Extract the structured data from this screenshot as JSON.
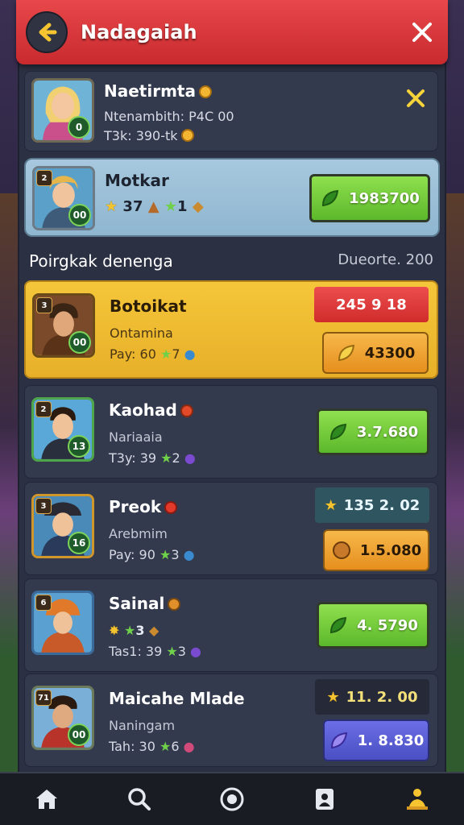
{
  "header": {
    "title": "Nadagaiah"
  },
  "profile": {
    "name": "Naetirmta",
    "line1": "Ntenambith: P4C 00",
    "line2": "T3k: 390-tk",
    "badge": "0"
  },
  "me": {
    "name": "Motkar",
    "stats": "37",
    "stats2": "1",
    "badge": "00",
    "rank": "2",
    "button_value": "1983700"
  },
  "section": {
    "title": "Poirgkak denenga",
    "meta": "Dueorte. 200"
  },
  "rows": [
    {
      "name": "Botoikat",
      "sub": "Ontamina",
      "stat": "Pay: 60",
      "stat_b": "7",
      "rank": "3",
      "badge": "00",
      "tag": "245 9 18",
      "button": "43300"
    },
    {
      "name": "Kaohad",
      "sub": "Nariaaia",
      "stat": "T3y: 39",
      "stat_b": "2",
      "rank": "2",
      "badge": "13",
      "button": "3.7.680"
    },
    {
      "name": "Preok",
      "sub": "Arebmim",
      "stat": "Pay: 90",
      "stat_b": "3",
      "rank": "3",
      "badge": "16",
      "tag": "135 2. 02",
      "button": "1.5.080"
    },
    {
      "name": "Sainal",
      "sub": "3",
      "stat": "Tas1: 39",
      "stat_b": "3",
      "rank": "6",
      "badge": "",
      "button": "4. 5790"
    },
    {
      "name": "Maicahe Mlade",
      "sub": "Naningam",
      "stat": "Tah: 30",
      "stat_b": "6",
      "rank": "71",
      "badge": "00",
      "tag": "11. 2. 00",
      "button": "1. 8.830"
    }
  ],
  "colors": {
    "header": "#d8383b",
    "gold_row": "#f0bf35",
    "green_btn": "#7bd045",
    "orange_btn": "#f0a436",
    "purple_btn": "#5a5fd8"
  },
  "nav": [
    "home-icon",
    "search-icon",
    "record-icon",
    "profile-card-icon",
    "trophy-icon"
  ]
}
